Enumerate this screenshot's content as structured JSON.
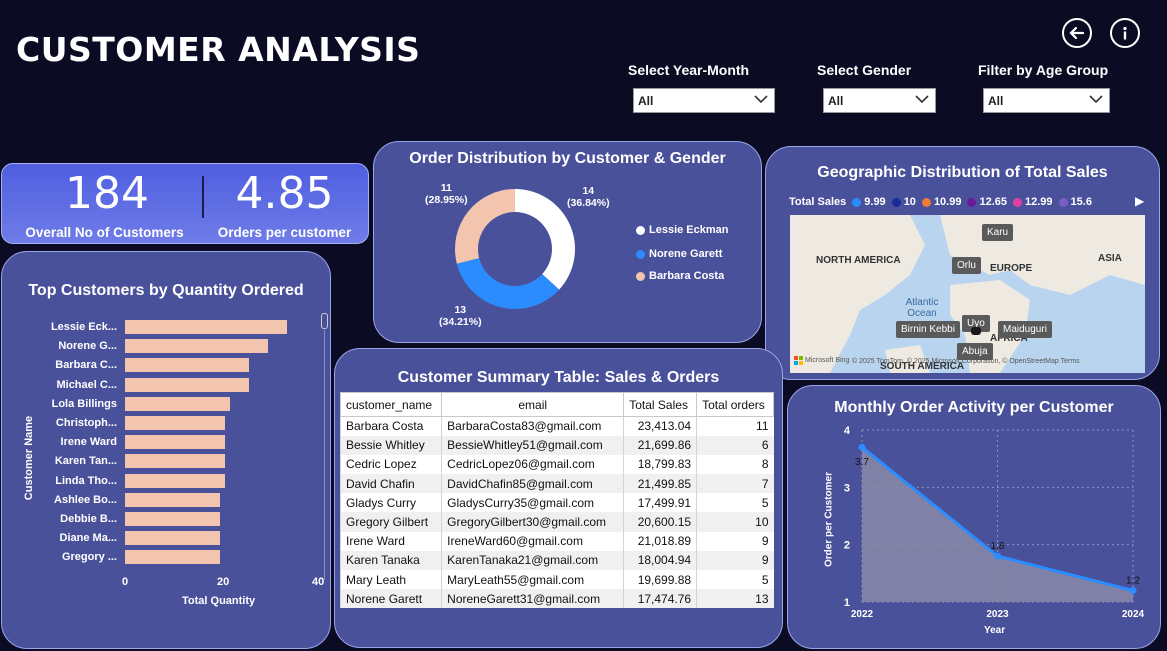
{
  "header": {
    "title": "CUSTOMER ANALYSIS",
    "back_icon": "arrow-left-circle-icon",
    "info_icon": "info-circle-icon"
  },
  "filters": [
    {
      "label": "Select Year-Month",
      "value": "All"
    },
    {
      "label": "Select Gender",
      "value": "All"
    },
    {
      "label": "Filter by Age Group",
      "value": "All"
    }
  ],
  "kpis": [
    {
      "value": "184",
      "label": "Overall No of Customers"
    },
    {
      "value": "4.85",
      "label": "Orders per customer"
    }
  ],
  "donut": {
    "title": "Order Distribution by Customer & Gender",
    "labels": [
      {
        "count": "14",
        "pct": "(36.84%)"
      },
      {
        "count": "13",
        "pct": "(34.21%)"
      },
      {
        "count": "11",
        "pct": "(28.95%)"
      }
    ],
    "legend": [
      "Lessie Eckman",
      "Norene Garett",
      "Barbara Costa"
    ],
    "colors": {
      "slice1": "#ffffff",
      "slice2": "#2b8cff",
      "slice3": "#f3c4ae"
    }
  },
  "chart_data": [
    {
      "type": "bar",
      "title": "Top Customers by Quantity Ordered",
      "xlabel": "Total Quantity",
      "ylabel": "Customer Name",
      "xlim": [
        0,
        40
      ],
      "x_ticks": [
        "0",
        "20",
        "40"
      ],
      "categories": [
        "Lessie Eck...",
        "Norene G...",
        "Barbara C...",
        "Michael C...",
        "Lola Billings",
        "Christoph...",
        "Irene Ward",
        "Karen Tan...",
        "Linda Tho...",
        "Ashlee Bo...",
        "Debbie B...",
        "Diane Ma...",
        "Gregory ..."
      ],
      "values": [
        34,
        30,
        26,
        26,
        22,
        21,
        21,
        21,
        21,
        20,
        20,
        20,
        20
      ]
    },
    {
      "type": "pie",
      "title": "Order Distribution by Customer & Gender",
      "categories": [
        "Lessie Eckman",
        "Norene Garett",
        "Barbara Costa"
      ],
      "values": [
        14,
        13,
        11
      ]
    },
    {
      "type": "area",
      "title": "Monthly Order Activity per Customer",
      "xlabel": "Year",
      "ylabel": "Order per Customer",
      "x": [
        "2022",
        "2023",
        "2024"
      ],
      "values": [
        3.7,
        1.8,
        1.2
      ],
      "data_labels": [
        "3.7",
        "1.8",
        "1.2"
      ],
      "ylim": [
        1,
        4
      ],
      "y_ticks": [
        "1",
        "2",
        "3",
        "4"
      ]
    }
  ],
  "map": {
    "title": "Geographic Distribution of Total Sales",
    "legend_title": "Total Sales",
    "legend_items": [
      {
        "label": "9.99",
        "color": "#2b8cff"
      },
      {
        "label": "10",
        "color": "#1a2a9a"
      },
      {
        "label": "10.99",
        "color": "#f07a3a"
      },
      {
        "label": "12.65",
        "color": "#6a1b9a"
      },
      {
        "label": "12.99",
        "color": "#e040a0"
      },
      {
        "label": "15.6",
        "color": "#7b5cc8"
      }
    ],
    "regions": [
      "NORTH AMERICA",
      "EUROPE",
      "ASIA",
      "AFRICA",
      "SOUTH AMERICA"
    ],
    "ocean": "Atlantic Ocean",
    "cities": [
      "Karu",
      "Orlu",
      "Uyo",
      "Birnin Kebbi",
      "Maiduguri",
      "Abuja"
    ],
    "attribution": "© 2025 TomTom, © 2025 Microsoft Corporation, © OpenStreetMap  Terms",
    "provider": "Microsoft Bing"
  },
  "table": {
    "title": "Customer Summary Table: Sales & Orders",
    "columns": [
      "customer_name",
      "email",
      "Total Sales",
      "Total orders"
    ],
    "rows": [
      [
        "Barbara Costa",
        "BarbaraCosta83@gmail.com",
        "23,413.04",
        "11"
      ],
      [
        "Bessie Whitley",
        "BessieWhitley51@gmail.com",
        "21,699.86",
        "6"
      ],
      [
        "Cedric Lopez",
        "CedricLopez06@gmail.com",
        "18,799.83",
        "8"
      ],
      [
        "David Chafin",
        "DavidChafin85@gmail.com",
        "21,499.85",
        "7"
      ],
      [
        "Gladys Curry",
        "GladysCurry35@gmail.com",
        "17,499.91",
        "5"
      ],
      [
        "Gregory Gilbert",
        "GregoryGilbert30@gmail.com",
        "20,600.15",
        "10"
      ],
      [
        "Irene Ward",
        "IreneWard60@gmail.com",
        "21,018.89",
        "9"
      ],
      [
        "Karen Tanaka",
        "KarenTanaka21@gmail.com",
        "18,004.94",
        "9"
      ],
      [
        "Mary Leath",
        "MaryLeath55@gmail.com",
        "19,699.88",
        "5"
      ],
      [
        "Norene Garett",
        "NoreneGarett31@gmail.com",
        "17,474.76",
        "13"
      ]
    ]
  }
}
